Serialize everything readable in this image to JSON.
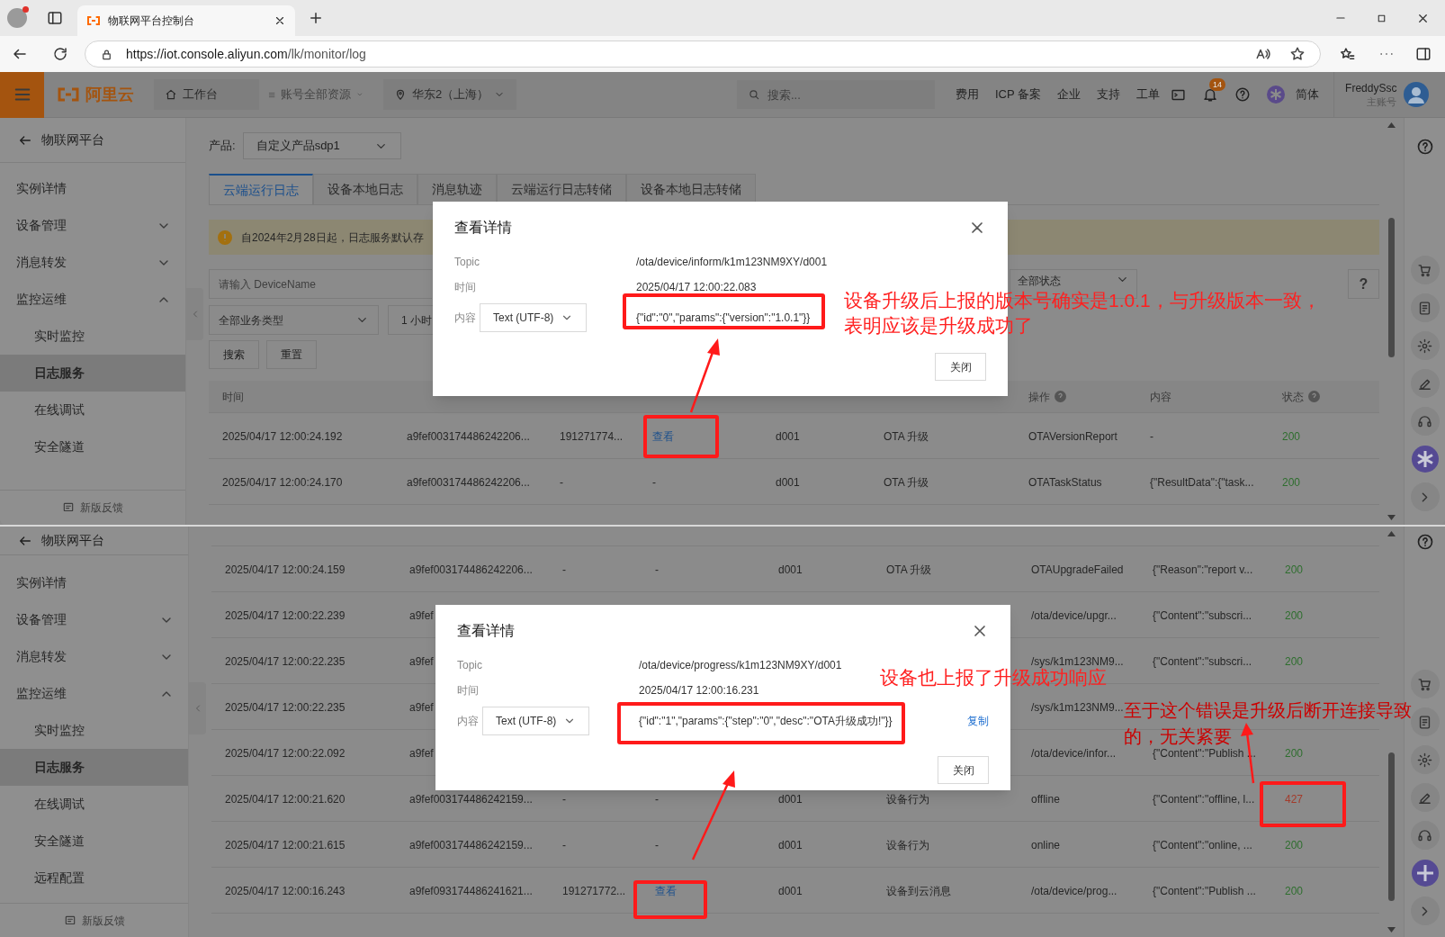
{
  "browser": {
    "tab_title": "物联网平台控制台",
    "url_host": "https://iot.console.aliyun.com",
    "url_path": "/lk/monitor/log"
  },
  "console_header": {
    "logo": "阿里云",
    "workbench": "工作台",
    "resources": "账号全部资源",
    "region": "华东2（上海）",
    "search_placeholder": "搜索...",
    "links": [
      "费用",
      "ICP 备案",
      "企业",
      "支持",
      "工单"
    ],
    "notification_count": "14",
    "language": "简体",
    "user": "FreddySsc",
    "account_type": "主账号"
  },
  "top_panel": {
    "sidebar": {
      "back": "物联网平台",
      "feedback": "新版反馈",
      "items": [
        {
          "label": "实例详情",
          "selected": false
        },
        {
          "label": "设备管理",
          "selected": false,
          "expanded": false
        },
        {
          "label": "消息转发",
          "selected": false,
          "expanded": false
        },
        {
          "label": "监控运维",
          "selected": false,
          "expanded": true,
          "children": [
            {
              "label": "实时监控",
              "selected": false
            },
            {
              "label": "日志服务",
              "selected": true
            },
            {
              "label": "在线调试",
              "selected": false
            },
            {
              "label": "安全隧道",
              "selected": false
            }
          ]
        }
      ]
    },
    "product_label": "产品:",
    "product": "自定义产品sdp1",
    "tabs": [
      {
        "label": "云端运行日志",
        "selected": true
      },
      {
        "label": "设备本地日志",
        "selected": false
      },
      {
        "label": "消息轨迹",
        "selected": false
      },
      {
        "label": "云端运行日志转储",
        "selected": false
      },
      {
        "label": "设备本地日志转储",
        "selected": false
      }
    ],
    "notice": "自2024年2月28日起，日志服务默认存",
    "device_placeholder": "请输入 DeviceName",
    "status_filter": "全部状态",
    "help": "?",
    "business_filter": "全部业务类型",
    "time_filter": "1 小时",
    "buttons": [
      "搜索",
      "重置"
    ],
    "table": {
      "header": {
        "time": {
          "label": "时间",
          "help": false
        },
        "operation": {
          "label": "操作",
          "help": true
        },
        "content": {
          "label": "内容",
          "help": false
        },
        "status": {
          "label": "状态",
          "help": true
        }
      },
      "rows": [
        {
          "time": "2025/04/17 12:00:24.192",
          "trace_id": "a9fef003174486242206...",
          "message_id": "191271774...",
          "message_content": "查看",
          "message_content_link": true,
          "device_name": "d001",
          "business_type": "OTA 升级",
          "operation": "OTAVersionReport",
          "content": "-",
          "status": {
            "text": "200",
            "color": "#2e6e2e"
          }
        },
        {
          "time": "2025/04/17 12:00:24.170",
          "trace_id": "a9fef003174486242206...",
          "message_id": "-",
          "message_content": "-",
          "message_content_link": false,
          "device_name": "d001",
          "business_type": "OTA 升级",
          "operation": "OTATaskStatus",
          "content": "{\"ResultData\":{\"task...",
          "status": {
            "text": "200",
            "color": "#2e6e2e"
          }
        }
      ]
    },
    "dialog": {
      "title": "查看详情",
      "fields": [
        {
          "label": "Topic",
          "value": "/ota/device/inform/k1m123NM9XY/d001"
        },
        {
          "label": "时间",
          "value": "2025/04/17 12:00:22.083"
        }
      ],
      "content_label": "内容",
      "format": "Text (UTF-8)",
      "content": "{\"id\":\"0\",\"params\":{\"version\":\"1.0.1\"}}",
      "close_button": "关闭"
    },
    "annotations": [
      "设备升级后上报的版本号确实是1.0.1，与升级版本一致，表明应该是升级成功了"
    ]
  },
  "bottom_panel": {
    "sidebar": {
      "back": "物联网平台",
      "feedback": "新版反馈",
      "items": [
        {
          "label": "实例详情",
          "selected": false
        },
        {
          "label": "设备管理",
          "selected": false,
          "expanded": false
        },
        {
          "label": "消息转发",
          "selected": false,
          "expanded": false
        },
        {
          "label": "监控运维",
          "selected": false,
          "expanded": true,
          "children": [
            {
              "label": "实时监控",
              "selected": false
            },
            {
              "label": "日志服务",
              "selected": true
            },
            {
              "label": "在线调试",
              "selected": false
            },
            {
              "label": "安全隧道",
              "selected": false
            },
            {
              "label": "远程配置",
              "selected": false
            }
          ]
        }
      ]
    },
    "table": {
      "rows": [
        {
          "time": "2025/04/17 12:00:24.159",
          "trace_id": "a9fef003174486242206...",
          "message_id": "-",
          "message_content": "-",
          "message_content_link": false,
          "device_name": "d001",
          "business_type": "OTA 升级",
          "operation": "OTAUpgradeFailed",
          "content": "{\"Reason\":\"report v...",
          "status": {
            "text": "200",
            "color": "#2e6e2e"
          }
        },
        {
          "time": "2025/04/17 12:00:22.239",
          "trace_id": "a9fef",
          "operation": "/ota/device/upgr...",
          "content": "{\"Content\":\"subscri...",
          "status": {
            "text": "200",
            "color": "#2e6e2e"
          }
        },
        {
          "time": "2025/04/17 12:00:22.235",
          "trace_id": "a9fef",
          "operation": "/sys/k1m123NM9...",
          "content": "{\"Content\":\"subscri...",
          "status": {
            "text": "200",
            "color": "#2e6e2e"
          }
        },
        {
          "time": "2025/04/17 12:00:22.235",
          "trace_id": "a9fef",
          "operation": "/sys/k1m123NM9..."
        },
        {
          "time": "2025/04/17 12:00:22.092",
          "trace_id": "a9fef",
          "operation": "/ota/device/infor...",
          "content": "{\"Content\":\"Publish ...",
          "status": {
            "text": "200",
            "color": "#2e6e2e"
          }
        },
        {
          "time": "2025/04/17 12:00:21.620",
          "trace_id": "a9fef003174486242159...",
          "message_id": "-",
          "message_content": "-",
          "message_content_link": false,
          "device_name": "d001",
          "business_type": "设备行为",
          "operation": "offline",
          "content": "{\"Content\":\"offline, l...",
          "status": {
            "text": "427",
            "color": "#a33b2b"
          }
        },
        {
          "time": "2025/04/17 12:00:21.615",
          "trace_id": "a9fef003174486242159...",
          "message_id": "-",
          "message_content": "-",
          "message_content_link": false,
          "device_name": "d001",
          "business_type": "设备行为",
          "operation": "online",
          "content": "{\"Content\":\"online, ...",
          "status": {
            "text": "200",
            "color": "#2e6e2e"
          }
        },
        {
          "time": "2025/04/17 12:00:16.243",
          "trace_id": "a9fef093174486241621...",
          "message_id": "191271772...",
          "message_content": "查看",
          "message_content_link": true,
          "device_name": "d001",
          "business_type": "设备到云消息",
          "operation": "/ota/device/prog...",
          "content": "{\"Content\":\"Publish ...",
          "status": {
            "text": "200",
            "color": "#2e6e2e"
          }
        }
      ]
    },
    "dialog": {
      "title": "查看详情",
      "fields": [
        {
          "label": "Topic",
          "value": "/ota/device/progress/k1m123NM9XY/d001"
        },
        {
          "label": "时间",
          "value": "2025/04/17 12:00:16.231"
        }
      ],
      "content_label": "内容",
      "format": "Text (UTF-8)",
      "content": "{\"id\":\"1\",\"params\":{\"step\":\"0\",\"desc\":\"OTA升级成功!\"}}",
      "copy": "复制",
      "close_button": "关闭"
    },
    "annotations": [
      "设备也上报了升级成功响应",
      "至于这个错误是升级后断开连接导致的，无关紧要"
    ]
  }
}
